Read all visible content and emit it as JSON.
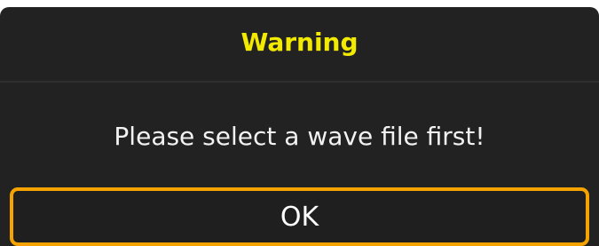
{
  "dialog": {
    "title": "Warning",
    "message": "Please select a wave file first!",
    "ok_label": "OK"
  },
  "colors": {
    "title": "#f2ea00",
    "background": "#222222",
    "button_border": "#f5a300"
  }
}
